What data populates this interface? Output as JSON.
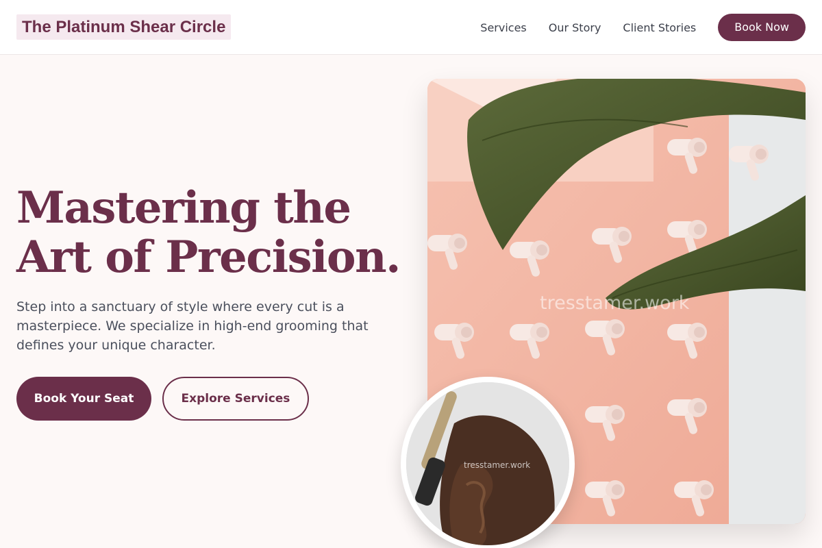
{
  "header": {
    "logo": "The Platinum Shear Circle",
    "nav": {
      "services": "Services",
      "our_story": "Our Story",
      "client_stories": "Client Stories"
    },
    "cta": "Book Now"
  },
  "hero": {
    "title_line1": "Mastering the",
    "title_line2": "Art of Precision.",
    "description": "Step into a sanctuary of style where every cut is a masterpiece. We specialize in high-end grooming that defines your unique character.",
    "primary_button": "Book Your Seat",
    "secondary_button": "Explore Services"
  },
  "images": {
    "main_watermark": "tresstamer.work",
    "circle_watermark": "tresstamer.work"
  },
  "colors": {
    "brand": "#6b2f4a",
    "logo_bg": "#f5e9ef",
    "page_bg": "#fdf8f7",
    "text": "#4a4f5c"
  }
}
